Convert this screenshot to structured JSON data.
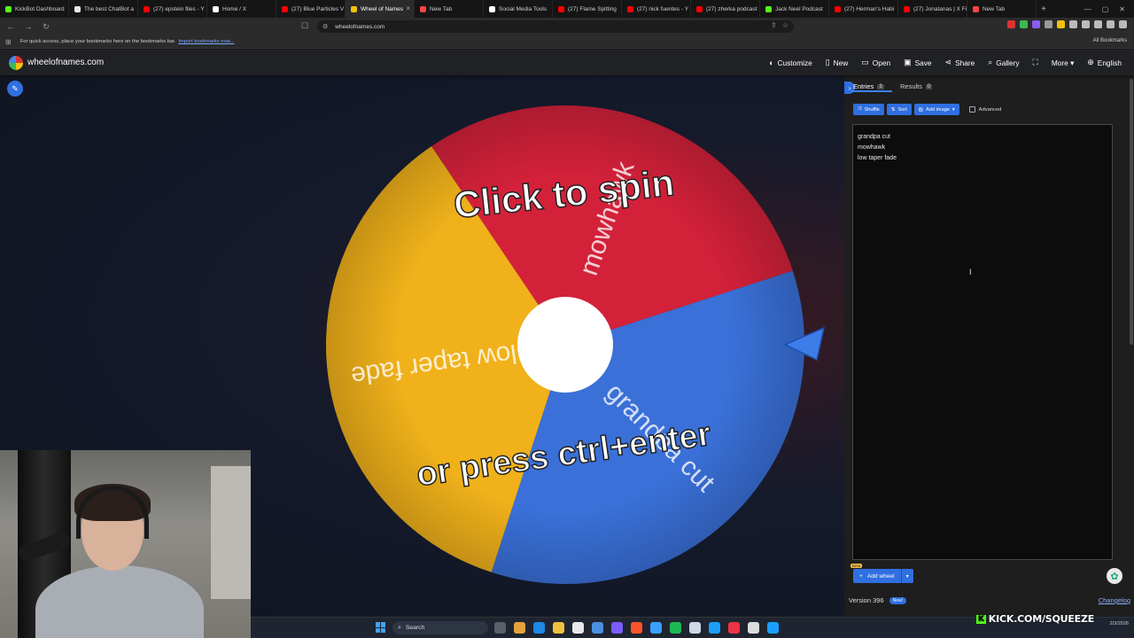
{
  "browser": {
    "tabs": [
      {
        "title": "KickBot Dashboard",
        "color": "#53fc18",
        "active": false
      },
      {
        "title": "The best ChatBot a",
        "color": "#e8e8e8",
        "active": false
      },
      {
        "title": "(27) epstein files - Y",
        "color": "#ff0000",
        "active": false
      },
      {
        "title": "Home / X",
        "color": "#ffffff",
        "active": false
      },
      {
        "title": "(27) Blue Particles V",
        "color": "#ff0000",
        "active": false
      },
      {
        "title": "Wheel of Names",
        "color": "#f4c20d",
        "active": true
      },
      {
        "title": "New Tab",
        "color": "#ff4444",
        "active": false
      },
      {
        "title": "Social Media Tools",
        "color": "#ffffff",
        "active": false
      },
      {
        "title": "(27) Flame Spitting",
        "color": "#ff0000",
        "active": false
      },
      {
        "title": "(27) nick fuentes - Y",
        "color": "#ff0000",
        "active": false
      },
      {
        "title": "(27) zherka podcast",
        "color": "#ff0000",
        "active": false
      },
      {
        "title": "Jack Neel Podcast",
        "color": "#53fc18",
        "active": false
      },
      {
        "title": "(27) Herman's Habi",
        "color": "#ff0000",
        "active": false
      },
      {
        "title": "(27) Jonatanas | X Fi",
        "color": "#ff0000",
        "active": false
      },
      {
        "title": "New Tab",
        "color": "#ff4444",
        "active": false
      }
    ],
    "url": "wheelofnames.com",
    "bookmarks_hint": "For quick access, place your bookmarks here on the bookmarks bar.",
    "import_link": "Import bookmarks now...",
    "all_bookmarks": "All Bookmarks"
  },
  "header": {
    "site_title": "wheelofnames.com",
    "menu": [
      {
        "icon": "palette-icon",
        "glyph": "◐",
        "label": "Customize"
      },
      {
        "icon": "new-file-icon",
        "glyph": "▯",
        "label": "New"
      },
      {
        "icon": "folder-icon",
        "glyph": "▭",
        "label": "Open"
      },
      {
        "icon": "save-icon",
        "glyph": "▣",
        "label": "Save"
      },
      {
        "icon": "share-icon",
        "glyph": "⋖",
        "label": "Share"
      },
      {
        "icon": "search-icon",
        "glyph": "⌕",
        "label": "Gallery"
      },
      {
        "icon": "fullscreen-icon",
        "glyph": "⛶",
        "label": ""
      },
      {
        "icon": "more-icon",
        "glyph": "",
        "label": "More ▾"
      },
      {
        "icon": "globe-icon",
        "glyph": "⊕",
        "label": "English"
      }
    ]
  },
  "wheel": {
    "segments": [
      {
        "label": "mowhawk",
        "color": "#d3213a"
      },
      {
        "label": "grandpa cut",
        "color": "#3a70d8"
      },
      {
        "label": "low taper fade",
        "color": "#f0b11a"
      }
    ],
    "overlay_line1": "Click to spin",
    "overlay_line2": "or press ctrl+enter"
  },
  "panel": {
    "tab_entries": "Entries",
    "entries_count": "3",
    "tab_results": "Results",
    "results_count": "0",
    "shuffle": "Shuffle",
    "sort": "Sort",
    "add_image": "Add image",
    "advanced": "Advanced",
    "entries": [
      "grandpa cut",
      "mowhawk",
      "low taper fade"
    ],
    "beta": "Beta",
    "add_wheel": "Add wheel",
    "version": "Version 396",
    "new_badge": "New!",
    "changelog": "Changelog"
  },
  "taskbar": {
    "search": "Search",
    "date": "2/3/2026"
  },
  "watermark": "KICK.COM/SQUEEZE",
  "colors": {
    "accent": "#2f6fe0",
    "kick_green": "#53fc18"
  }
}
